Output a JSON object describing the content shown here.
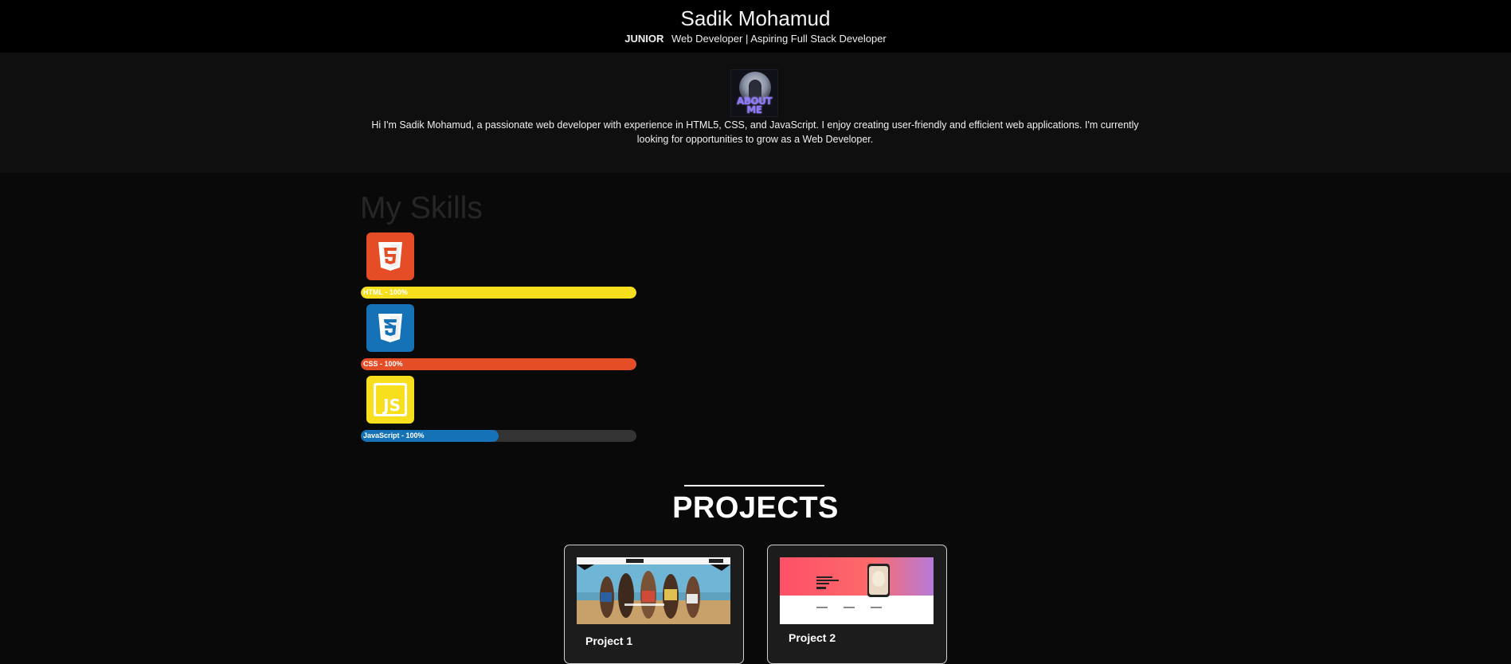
{
  "header": {
    "name": "Sadik Mohamud",
    "subtitle_strong": "JUNIOR",
    "subtitle_rest": "Web Developer | Aspiring Full Stack Developer"
  },
  "about": {
    "avatar_text_line1": "ABOUT",
    "avatar_text_line2": "ME",
    "bio": "Hi I'm Sadik Mohamud, a passionate web developer with experience in HTML5, CSS, and JavaScript. I enjoy creating user-friendly and efficient web applications. I'm currently looking for opportunities to grow as a Web Developer."
  },
  "skills": {
    "title": "My Skills",
    "items": [
      {
        "icon": "html5-icon",
        "label": "HTML - 100%",
        "progress_percent": 100,
        "bar_color": "#f7df1e",
        "icon_color": "#e44d26"
      },
      {
        "icon": "css3-icon",
        "label": "CSS - 100%",
        "progress_percent": 100,
        "bar_color": "#e44d26",
        "icon_color": "#1572b6"
      },
      {
        "icon": "javascript-icon",
        "label": "JavaScript - 100%",
        "progress_percent": 50,
        "bar_color": "#1572b6",
        "icon_color": "#f7df1e",
        "icon_text": "JS"
      }
    ]
  },
  "projects": {
    "title": "PROJECTS",
    "cards": [
      {
        "title": "Project 1"
      },
      {
        "title": "Project 2"
      }
    ]
  },
  "colors": {
    "header_bg": "#000000",
    "about_bg": "#0f0f0f",
    "page_bg": "#090909",
    "card_bg": "#1c1c1c"
  }
}
